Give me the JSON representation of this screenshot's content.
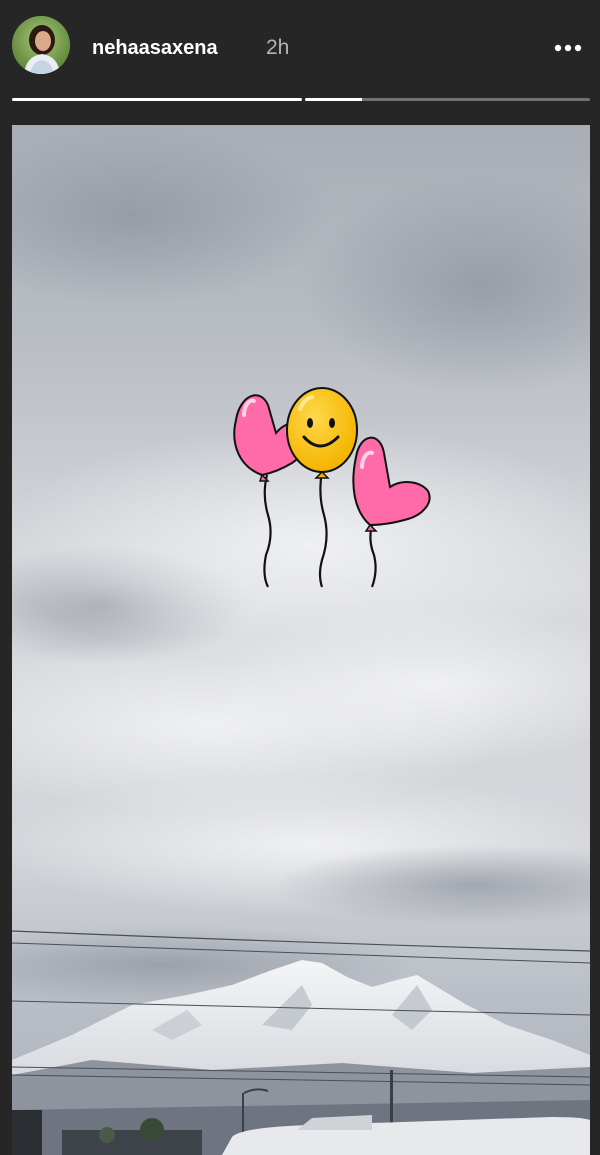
{
  "story": {
    "username": "nehaasaxena",
    "timestamp": "2h",
    "progress_segments": [
      {
        "filled_fraction": 1.0
      },
      {
        "filled_fraction": 0.2
      }
    ]
  },
  "icons": {
    "more": "more-horizontal-icon"
  },
  "colors": {
    "background": "#262626",
    "text_primary": "#ffffff",
    "text_secondary": "#b3b3b3",
    "balloon_pink": "#ff6aa8",
    "balloon_yellow": "#ffc21a"
  },
  "stickers": [
    "heart-balloon-left",
    "smiley-balloon",
    "heart-balloon-right"
  ]
}
